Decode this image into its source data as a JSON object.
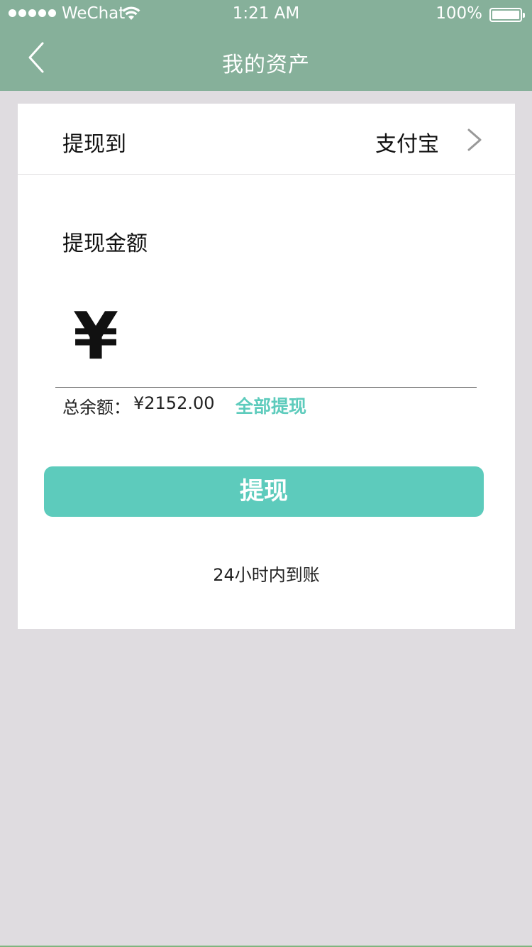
{
  "status_bar": {
    "carrier": "WeChat",
    "time": "1:21 AM",
    "battery": "100%",
    "battery_level": 1.0,
    "signal_bars": 5,
    "icons": [
      "signal-dots",
      "wifi-icon",
      "battery-icon"
    ]
  },
  "nav": {
    "title": "我的资产",
    "back_icon": "chevron-left-icon"
  },
  "withdraw_to": {
    "label": "提现到",
    "value": "支付宝",
    "icon": "chevron-right-icon"
  },
  "amount": {
    "label": "提现金额",
    "currency_symbol": "¥",
    "value": ""
  },
  "balance": {
    "label": "总余额：",
    "value": "¥2152.00",
    "withdraw_all": "全部提现"
  },
  "submit": {
    "label": "提现"
  },
  "note": "24小时内到账",
  "colors": {
    "header": "#86b09a",
    "accent": "#5dcbbc",
    "background": "#dfdce0",
    "card": "#ffffff"
  }
}
